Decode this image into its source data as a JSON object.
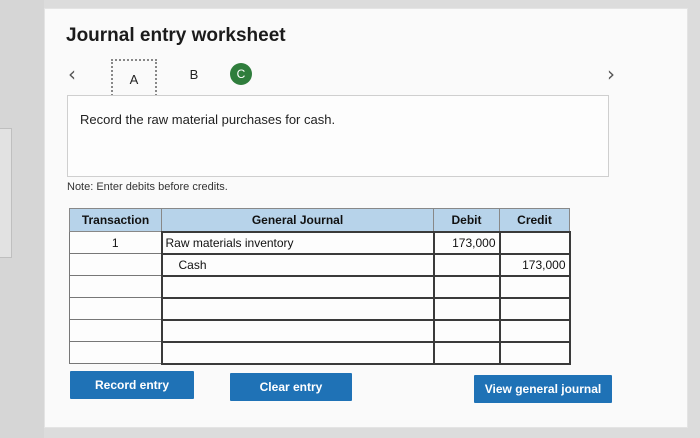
{
  "worksheet": {
    "title": "Journal entry worksheet",
    "tabs": [
      "A",
      "B",
      "C"
    ],
    "prompt": "Record the raw material purchases for cash.",
    "note": "Note: Enter debits before credits."
  },
  "journal": {
    "headers": {
      "transaction": "Transaction",
      "general_journal": "General Journal",
      "debit": "Debit",
      "credit": "Credit"
    },
    "rows": [
      {
        "transaction": "1",
        "account": "Raw materials inventory",
        "debit": "173,000",
        "credit": ""
      },
      {
        "transaction": "",
        "account": "Cash",
        "debit": "",
        "credit": "173,000"
      },
      {
        "transaction": "",
        "account": "",
        "debit": "",
        "credit": ""
      },
      {
        "transaction": "",
        "account": "",
        "debit": "",
        "credit": ""
      },
      {
        "transaction": "",
        "account": "",
        "debit": "",
        "credit": ""
      },
      {
        "transaction": "",
        "account": "",
        "debit": "",
        "credit": ""
      }
    ]
  },
  "buttons": {
    "record": "Record entry",
    "clear": "Clear entry",
    "view": "View general journal"
  },
  "colors": {
    "header_bg": "#b7d3ea",
    "button_bg": "#1f72b6",
    "active_tab": "#2f7d3c"
  }
}
